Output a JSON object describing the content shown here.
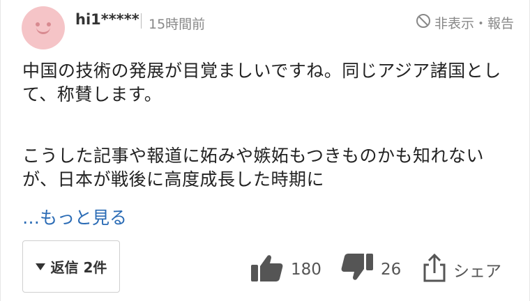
{
  "user": {
    "name": "hi1*****",
    "time": "15時間前"
  },
  "report": {
    "label": "非表示・報告"
  },
  "comment": {
    "paragraph1": "中国の技術の発展が目覚ましいですね。同じアジア諸国として、称賛します。",
    "paragraph2": "こうした記事や報道に妬みや嫉妬もつきものかも知れないが、日本が戦後に高度成長した時期に",
    "more_label": "…もっと見る"
  },
  "reply": {
    "label": "返信 2件"
  },
  "actions": {
    "likes": "180",
    "dislikes": "26",
    "share_label": "シェア"
  },
  "colors": {
    "link": "#2a6bb5",
    "avatar_bg": "#f5c4c7",
    "icon": "#555555"
  }
}
